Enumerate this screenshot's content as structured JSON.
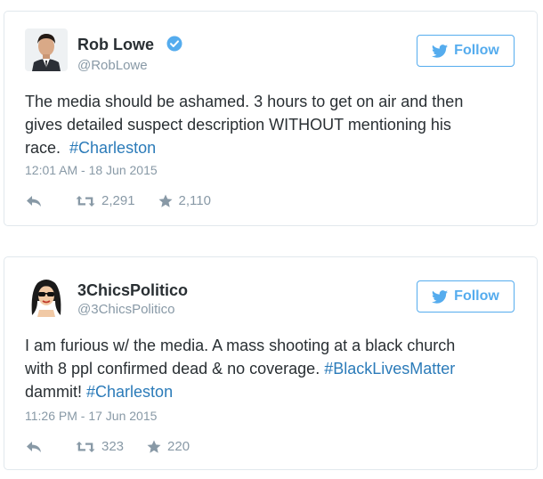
{
  "accent_color": "#55acee",
  "link_color": "#2b7bb9",
  "tweets": [
    {
      "name": "Rob Lowe",
      "handle": "@RobLowe",
      "verified": true,
      "follow_label": "Follow",
      "text_line1": "The media should be ashamed. 3 hours to get on air and then",
      "text_line2": "gives detailed suspect description WITHOUT  mentioning his",
      "text_line3_prefix": "race.  ",
      "hashtag": "#Charleston",
      "timestamp": "12:01 AM - 18 Jun 2015",
      "retweets": "2,291",
      "favorites": "2,110",
      "icons": [
        "reply-icon",
        "retweet-icon",
        "favorite-icon"
      ]
    },
    {
      "name": "3ChicsPolitico",
      "handle": "@3ChicsPolitico",
      "verified": false,
      "follow_label": "Follow",
      "text_line1": "I am furious w/ the media. A mass shooting at a black church",
      "text_line2_prefix": "with 8 ppl confirmed dead & no coverage. ",
      "hashtag1": "#BlackLivesMatter",
      "text_line3_prefix": "dammit! ",
      "hashtag2": "#Charleston",
      "timestamp": "11:26 PM - 17 Jun 2015",
      "retweets": "323",
      "favorites": "220",
      "icons": [
        "reply-icon",
        "retweet-icon",
        "favorite-icon"
      ]
    }
  ]
}
